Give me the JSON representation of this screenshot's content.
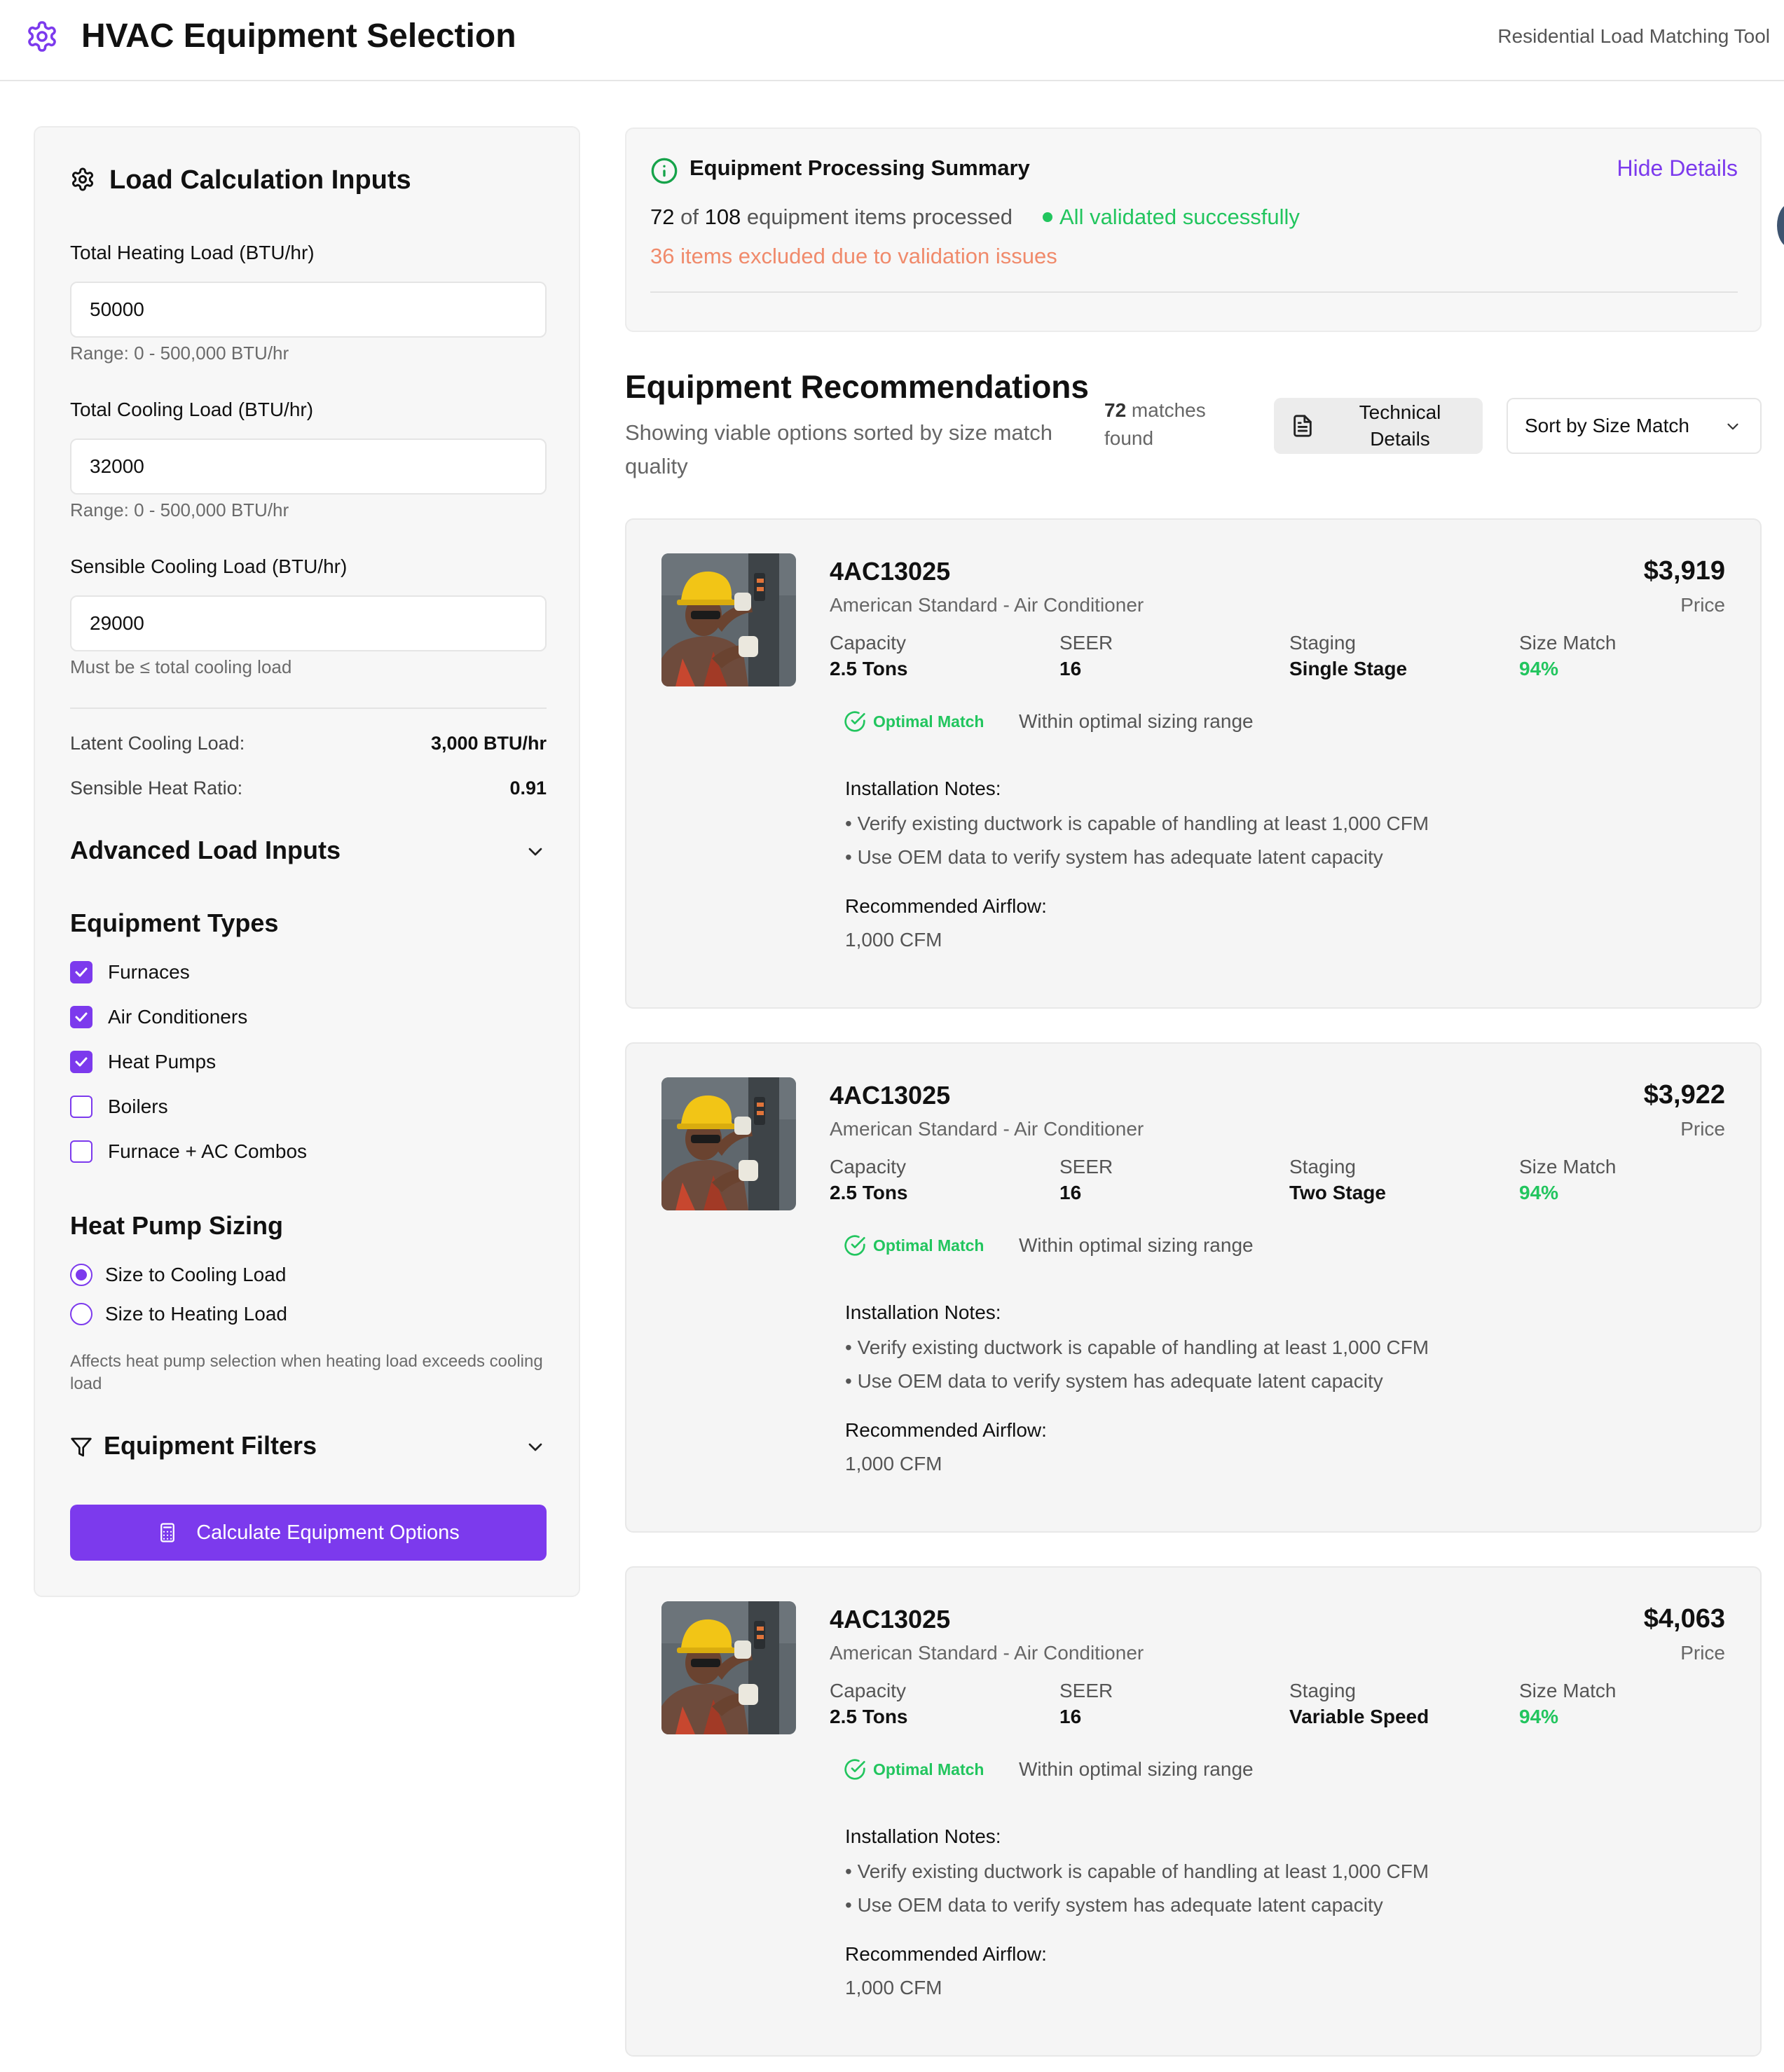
{
  "header": {
    "title": "HVAC Equipment Selection",
    "subtitle": "Residential Load Matching Tool",
    "logo_icon": "gear-icon",
    "accent": "#7c3aed"
  },
  "inputs": {
    "heading": "Load Calculation Inputs",
    "heating": {
      "label": "Total Heating Load (BTU/hr)",
      "value": "50000",
      "help": "Range: 0 - 500,000 BTU/hr"
    },
    "cooling": {
      "label": "Total Cooling Load (BTU/hr)",
      "value": "32000",
      "help": "Range: 0 - 500,000 BTU/hr"
    },
    "sensible": {
      "label": "Sensible Cooling Load (BTU/hr)",
      "value": "29000",
      "help": "Must be ≤ total cooling load"
    },
    "latent": {
      "label": "Latent Cooling Load:",
      "value": "3,000 BTU/hr"
    },
    "shr": {
      "label": "Sensible Heat Ratio:",
      "value": "0.91"
    }
  },
  "advanced": {
    "label": "Advanced Load Inputs",
    "expanded": false
  },
  "equipment_types": {
    "heading": "Equipment Types",
    "items": [
      {
        "label": "Furnaces",
        "checked": true
      },
      {
        "label": "Air Conditioners",
        "checked": true
      },
      {
        "label": "Heat Pumps",
        "checked": true
      },
      {
        "label": "Boilers",
        "checked": false
      },
      {
        "label": "Furnace + AC Combos",
        "checked": false
      }
    ]
  },
  "heat_pump": {
    "heading": "Heat Pump Sizing",
    "options": [
      {
        "label": "Size to Cooling Load",
        "selected": true
      },
      {
        "label": "Size to Heating Load",
        "selected": false
      }
    ],
    "help": "Affects heat pump selection when heating load exceeds cooling load"
  },
  "filters": {
    "label": "Equipment Filters",
    "expanded": false
  },
  "calc_button": {
    "label": "Calculate Equipment Options"
  },
  "summary": {
    "title": "Equipment Processing Summary",
    "toggle": "Hide Details",
    "processed": "72",
    "of_text": " of ",
    "total": "108",
    "processed_suffix": " equipment items processed",
    "validated": "All validated successfully",
    "excluded": "36 items excluded due to validation issues",
    "success_color": "#22c55e",
    "warning_color": "#f08a6b"
  },
  "recommendations": {
    "title": "Equipment Recommendations",
    "subtitle": "Showing viable options sorted by size match quality",
    "count": "72",
    "count_suffix": " matches found",
    "tech_button": "Technical Details",
    "sort_label": "Sort by Size Match"
  },
  "cards": [
    {
      "model": "4AC13025",
      "brand": "American Standard - Air Conditioner",
      "price": "$3,919",
      "price_label": "Price",
      "capacity_label": "Capacity",
      "capacity": "2.5 Tons",
      "seer_label": "SEER",
      "seer": "16",
      "staging_label": "Staging",
      "staging": "Single Stage",
      "size_label": "Size Match",
      "size_match": "94%",
      "badge": "Optimal Match",
      "badge_desc": "Within optimal sizing range",
      "notes_title": "Installation Notes:",
      "notes": [
        "• Verify existing ductwork is capable of handling at least 1,000 CFM",
        "• Use OEM data to verify system has adequate latent capacity"
      ],
      "airflow_title": "Recommended Airflow:",
      "airflow": "1,000 CFM"
    },
    {
      "model": "4AC13025",
      "brand": "American Standard - Air Conditioner",
      "price": "$3,922",
      "price_label": "Price",
      "capacity_label": "Capacity",
      "capacity": "2.5 Tons",
      "seer_label": "SEER",
      "seer": "16",
      "staging_label": "Staging",
      "staging": "Two Stage",
      "size_label": "Size Match",
      "size_match": "94%",
      "badge": "Optimal Match",
      "badge_desc": "Within optimal sizing range",
      "notes_title": "Installation Notes:",
      "notes": [
        "• Verify existing ductwork is capable of handling at least 1,000 CFM",
        "• Use OEM data to verify system has adequate latent capacity"
      ],
      "airflow_title": "Recommended Airflow:",
      "airflow": "1,000 CFM"
    },
    {
      "model": "4AC13025",
      "brand": "American Standard - Air Conditioner",
      "price": "$4,063",
      "price_label": "Price",
      "capacity_label": "Capacity",
      "capacity": "2.5 Tons",
      "seer_label": "SEER",
      "seer": "16",
      "staging_label": "Staging",
      "staging": "Variable Speed",
      "size_label": "Size Match",
      "size_match": "94%",
      "badge": "Optimal Match",
      "badge_desc": "Within optimal sizing range",
      "notes_title": "Installation Notes:",
      "notes": [
        "• Verify existing ductwork is capable of handling at least 1,000 CFM",
        "• Use OEM data to verify system has adequate latent capacity"
      ],
      "airflow_title": "Recommended Airflow:",
      "airflow": "1,000 CFM"
    }
  ]
}
